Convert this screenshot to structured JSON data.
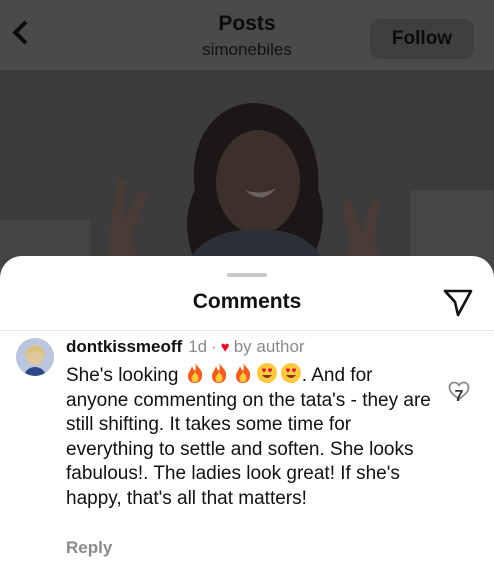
{
  "header": {
    "title": "Posts",
    "subtitle": "simonebiles",
    "follow_label": "Follow"
  },
  "sheet": {
    "title": "Comments"
  },
  "comment": {
    "username": "dontkissmeoff",
    "time": "1d",
    "separator": "·",
    "by_author": "by author",
    "text_before": "She's looking ",
    "emojis": [
      "fire",
      "fire",
      "fire",
      "heart-eyes",
      "heart-eyes"
    ],
    "text_after": ". And for anyone commenting on the tata's - they are still shifting. It takes some time for everything to settle and soften. She looks fabulous!. The ladies look great! If she's happy, that's all that matters!",
    "reply_label": "Reply",
    "like_count": "7"
  },
  "colors": {
    "overlay_dim": "#2e2e2f",
    "author_heart": "#e8112d",
    "muted_text": "#8a8a8e"
  }
}
